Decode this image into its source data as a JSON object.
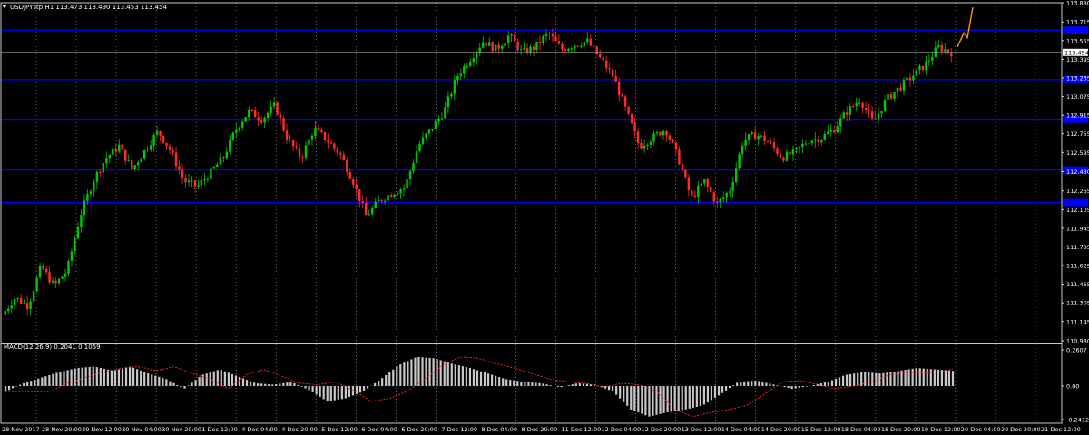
{
  "window": {
    "symbol_header": "USDJPYstp,H1  113.473 113.490 113.453 113.454",
    "current_price_tag": "113.454"
  },
  "colors": {
    "background": "#000000",
    "grid": "#ffffff",
    "bull_candle": "#00c800",
    "bear_candle": "#ff2a2a",
    "hline": "#0000ff",
    "price_line": "#9a9a9a",
    "macd_hist": "#c8c8c8",
    "macd_signal": "#ff2a2a",
    "projection": "#ff9900",
    "separator": "#c8c8c8"
  },
  "chart_data": [
    {
      "type": "candlestick",
      "title": "USDJPYstp,H1",
      "ylim": [
        110.98,
        113.88
      ],
      "y_ticks": [
        "113.880",
        "113.715",
        "113.555",
        "113.395",
        "113.235",
        "113.075",
        "112.915",
        "112.755",
        "112.595",
        "112.430",
        "112.265",
        "112.105",
        "111.945",
        "111.785",
        "111.625",
        "111.465",
        "111.305",
        "111.145",
        "110.980"
      ],
      "x_ticks": [
        "28 Nov 2017",
        "28 Nov 20:00",
        "29 Nov 12:00",
        "30 Nov 04:00",
        "30 Nov 20:00",
        "1 Dec 12:00",
        "4 Dec 04:00",
        "4 Dec 20:00",
        "5 Dec 12:00",
        "6 Dec 04:00",
        "6 Dec 20:00",
        "7 Dec 12:00",
        "8 Dec 04:00",
        "8 Dec 20:00",
        "11 Dec 12:00",
        "12 Dec 04:00",
        "12 Dec 20:00",
        "13 Dec 12:00",
        "14 Dec 04:00",
        "14 Dec 20:00",
        "15 Dec 12:00",
        "18 Dec 04:00",
        "18 Dec 20:00",
        "19 Dec 12:00",
        "20 Dec 04:00",
        "20 Dec 20:00",
        "21 Dec 12:00"
      ],
      "horizontal_lines": [
        113.645,
        113.22,
        112.88,
        112.445,
        112.165
      ],
      "last_price": 113.454,
      "price_path": [
        111.2,
        111.35,
        111.28,
        111.62,
        111.45,
        111.58,
        112.05,
        112.35,
        112.55,
        112.65,
        112.45,
        112.62,
        112.78,
        112.6,
        112.35,
        112.3,
        112.42,
        112.55,
        112.8,
        112.95,
        112.88,
        113.0,
        112.7,
        112.55,
        112.8,
        112.7,
        112.58,
        112.35,
        112.05,
        112.18,
        112.25,
        112.3,
        112.65,
        112.8,
        112.95,
        113.25,
        113.4,
        113.55,
        113.48,
        113.6,
        113.45,
        113.5,
        113.62,
        113.48,
        113.52,
        113.55,
        113.4,
        113.25,
        112.95,
        112.65,
        112.72,
        112.8,
        112.55,
        112.2,
        112.35,
        112.15,
        112.28,
        112.7,
        112.75,
        112.68,
        112.55,
        112.6,
        112.7,
        112.72,
        112.8,
        112.95,
        113.05,
        112.85,
        113.05,
        113.15,
        113.25,
        113.35,
        113.5,
        113.454
      ],
      "projection_path": [
        113.5,
        113.62,
        113.58,
        113.84
      ],
      "legend": "none",
      "grid": true
    },
    {
      "type": "bar",
      "title": "MACD(12,26,9) 0.2041 0.1059",
      "y_ticks": [
        "0.2607",
        "0.00",
        "-0.2412"
      ],
      "ylim": [
        -0.2412,
        0.2607
      ],
      "macd_path": [
        -0.04,
        0.02,
        0.06,
        0.1,
        0.13,
        0.14,
        0.11,
        0.14,
        0.09,
        0.05,
        -0.02,
        0.08,
        0.12,
        0.07,
        0.02,
        0.01,
        0.03,
        -0.03,
        -0.11,
        -0.09,
        -0.04,
        0.05,
        0.15,
        0.21,
        0.2,
        0.16,
        0.13,
        0.09,
        0.05,
        0.03,
        0.02,
        -0.01,
        0.02,
        0.01,
        -0.04,
        -0.17,
        -0.22,
        -0.19,
        -0.17,
        -0.14,
        -0.06,
        0.03,
        0.04,
        0.01,
        -0.02,
        0.0,
        0.03,
        0.08,
        0.1,
        0.09,
        0.11,
        0.13,
        0.12,
        0.11
      ],
      "signal_lag": 3,
      "legend": "none"
    }
  ]
}
